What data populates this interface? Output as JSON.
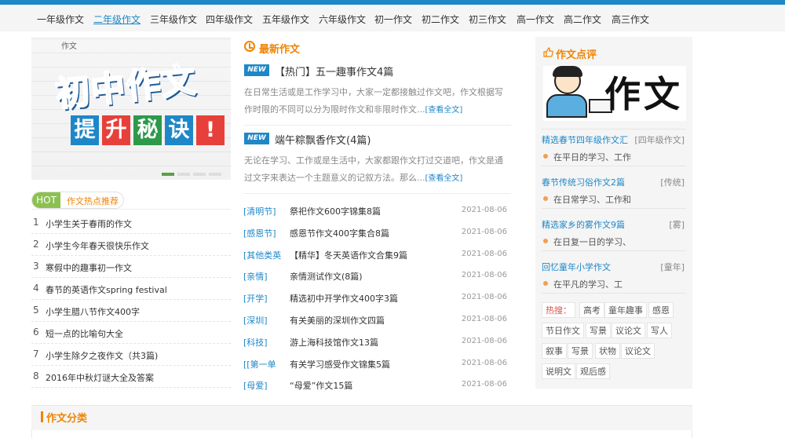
{
  "nav": [
    "一年级作文",
    "二年级作文",
    "三年级作文",
    "四年级作文",
    "五年级作文",
    "六年级作文",
    "初一作文",
    "初二作文",
    "初三作文",
    "高一作文",
    "高二作文",
    "高三作文"
  ],
  "nav_active": 1,
  "banner": {
    "tag": "作文",
    "big": "初中作文",
    "sub": [
      "提",
      "升",
      "秘",
      "诀",
      "!"
    ]
  },
  "hot": {
    "badge": "HOT",
    "title": "作文热点推荐",
    "items": [
      {
        "num": "1",
        "text": "小学生关于春雨的作文"
      },
      {
        "num": "2",
        "text": "小学生今年春天很快乐作文"
      },
      {
        "num": "3",
        "text": "寒假中的趣事初一作文"
      },
      {
        "num": "4",
        "text": "春节的英语作文spring festival"
      },
      {
        "num": "5",
        "text": "小学生腊八节作文400字"
      },
      {
        "num": "6",
        "text": "短一点的比喻句大全"
      },
      {
        "num": "7",
        "text": "小学生除夕之夜作文（共3篇)"
      },
      {
        "num": "8",
        "text": "2016年中秋灯谜大全及答案"
      }
    ]
  },
  "latest": {
    "title": "最新作文",
    "articles": [
      {
        "badge": "NEW",
        "title": "【热门】五一趣事作文4篇",
        "desc1": "在日常生活或是工作学习中，大家一定都接触过作文吧，作文根据写",
        "desc2": "作时限的不同可以分为限时作文和非限时作文...",
        "more": "[查看全文]"
      },
      {
        "badge": "NEW",
        "title": "端午粽飘香作文(4篇)",
        "desc1": "无论在学习、工作或是生活中，大家都跟作文打过交道吧，作文是通",
        "desc2": "过文字来表达一个主题意义的记叙方法。那么...",
        "more": "[查看全文]"
      }
    ],
    "list": [
      {
        "cat": "[清明节]",
        "title": "祭祀作文600字锦集8篇",
        "date": "2021-08-06"
      },
      {
        "cat": "[感恩节]",
        "title": "感恩节作文400字集合8篇",
        "date": "2021-08-06"
      },
      {
        "cat": "[其他类英",
        "title": "【精华】冬天英语作文合集9篇",
        "date": "2021-08-06"
      },
      {
        "cat": "[亲情]",
        "title": "亲情测试作文(8篇)",
        "date": "2021-08-06"
      },
      {
        "cat": "[开学]",
        "title": "精选初中开学作文400字3篇",
        "date": "2021-08-06"
      },
      {
        "cat": "[深圳]",
        "title": "有关美丽的深圳作文四篇",
        "date": "2021-08-06"
      },
      {
        "cat": "[科技]",
        "title": "游上海科技馆作文13篇",
        "date": "2021-08-06"
      },
      {
        "cat": "[[第一单",
        "title": "有关学习感受作文锦集5篇",
        "date": "2021-08-06"
      },
      {
        "cat": "[母爱]",
        "title": "“母爱”作文15篇",
        "date": "2021-08-06"
      }
    ]
  },
  "review": {
    "title": "作文点评",
    "image_chars": [
      "作",
      "文"
    ],
    "items": [
      {
        "title": "精选春节四年级作文汇",
        "tag": "[四年级作文]",
        "desc": "在平日的学习、工作"
      },
      {
        "title": "春节传统习俗作文2篇",
        "tag": "[传统]",
        "desc": "在日常学习、工作和"
      },
      {
        "title": "精选家乡的雾作文9篇",
        "tag": "[雾]",
        "desc": "在日复一日的学习、"
      },
      {
        "title": "回忆童年小学作文",
        "tag": "[童年]",
        "desc": "在平凡的学习、工"
      }
    ],
    "hotword_label": "热搜：",
    "tags": [
      "高考",
      "童年趣事",
      "感恩",
      "节日作文",
      "写景",
      "议论文",
      "写人",
      "叙事",
      "写景",
      "状物",
      "议论文",
      "说明文",
      "观后感"
    ]
  },
  "category": {
    "title": "作文分类"
  },
  "colors": {
    "accent": "#1e87c8",
    "orange": "#f08300",
    "hot_green": "#8cc152"
  }
}
